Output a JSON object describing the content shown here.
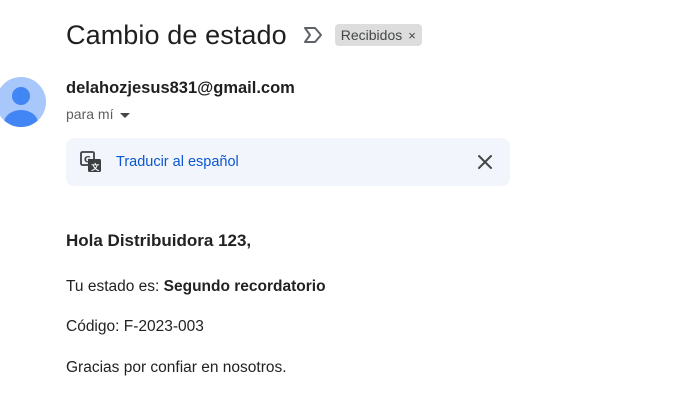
{
  "email": {
    "subject": "Cambio de estado",
    "label": {
      "name": "Recibidos",
      "close_glyph": "×"
    },
    "important_marker_icon": "label-important-icon",
    "sender": "delahozjesus831@gmail.com",
    "recipient_text": "para mí",
    "avatar_icon": "default-avatar-icon",
    "translate_banner": {
      "icon": "google-translate-icon",
      "link_text": "Traducir al español",
      "close_icon": "close-icon",
      "background": "#f2f6fc",
      "link_color": "#0b57d0"
    },
    "body": {
      "greeting": "Hola Distribuidora 123,",
      "status_prefix": "Tu estado es: ",
      "status_value": "Segundo recordatorio",
      "code_line": "Código: F-2023-003",
      "thanks_line": "Gracias por confiar en nosotros."
    }
  },
  "colors": {
    "avatar_background": "#a8c7fa",
    "avatar_figure": "#4285f4",
    "chip_background": "#dddddd"
  }
}
